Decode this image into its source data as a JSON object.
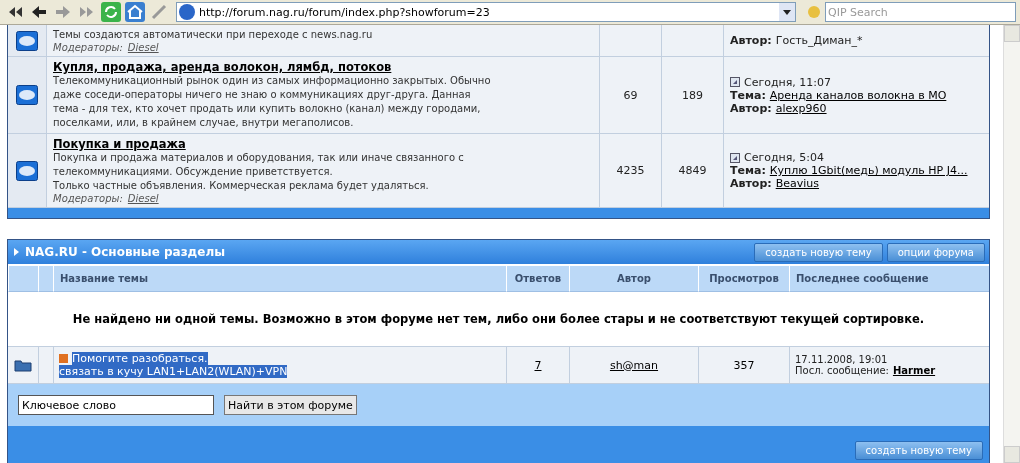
{
  "browser": {
    "address": "http://forum.nag.ru/forum/index.php?showforum=23",
    "search": {
      "placeholder": "QIP Search"
    }
  },
  "forums": [
    {
      "description": "Темы создаются автоматически при переходе с news.nag.ru",
      "moderators_label": "Модераторы:",
      "moderator": "Diesel",
      "last": {
        "author_label": "Автор:",
        "author": "Гость_Диман_*",
        "author_link": false
      }
    },
    {
      "title": "Купля, продажа, аренда волокон, лямбд, потоков",
      "description": "Телекоммуникационный рынок один из самых информационно закрытых. Обычно даже соседи-операторы ничего не знаю о коммуникациях друг-друга. Данная тема - для тех, кто хочет продать или купить волокно (канал) между городами, поселками, или, в крайнем случае, внутри мегаполисов.",
      "topics": "69",
      "replies": "189",
      "last": {
        "date": "Сегодня, 11:07",
        "topic_label": "Тема:",
        "topic": "Аренда каналов волокна в МО",
        "author_label": "Автор:",
        "author": "alexp960",
        "author_link": true
      }
    },
    {
      "title": "Покупка и продажа",
      "description": "Покупка и продажа материалов и оборудования, так или иначе связанного с телекоммуникациями. Обсуждение приветствуется.\nТолько частные объявления. Коммерческая реклама будет удаляться.",
      "moderators_label": "Модераторы:",
      "moderator": "Diesel",
      "topics": "4235",
      "replies": "4849",
      "last": {
        "date": "Сегодня, 5:04",
        "topic_label": "Тема:",
        "topic": "Куплю 1Gbit(медь) модуль HP J4...",
        "author_label": "Автор:",
        "author": "Beavius",
        "author_link": true
      }
    }
  ],
  "section": {
    "title": "NAG.RU - Основные разделы",
    "buttons": [
      "создать новую тему",
      "опции форума"
    ],
    "columns": [
      "Название темы",
      "Ответов",
      "Автор",
      "Просмотров",
      "Последнее сообщение"
    ],
    "empty_message": "Не найдено ни одной темы. Возможно в этом форуме нет тем, либо они более стары и не соответствуют текущей сортировке.",
    "topics": [
      {
        "title": "Помогите разобраться.",
        "description": "связать в кучу LAN1+LAN2(WLAN)+VPN",
        "highlighted": true,
        "replies": "7",
        "author": "sh@man",
        "views": "357",
        "last_date": "17.11.2008, 19:01",
        "last_label": "Посл. сообщение:",
        "last_author": "Harmer"
      }
    ],
    "search": {
      "value": "Ключевое слово",
      "button": "Найти в этом форуме"
    },
    "footer_button": "создать новую тему"
  }
}
